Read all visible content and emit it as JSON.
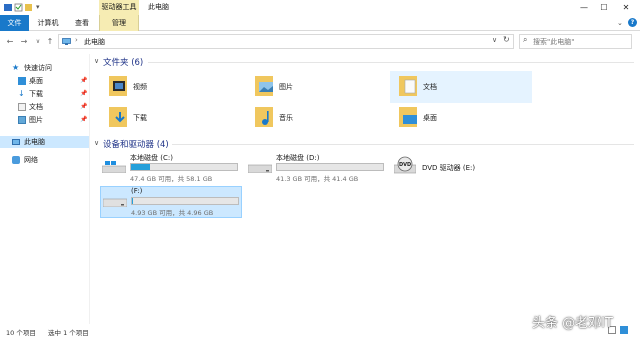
{
  "window": {
    "title": "此电脑",
    "contextual_group": "驱动器工具"
  },
  "ribbon": {
    "tabs": [
      "文件",
      "计算机",
      "查看",
      "管理"
    ]
  },
  "address": {
    "crumb": "此电脑",
    "search_placeholder": "搜索\"此电脑\""
  },
  "sidebar": {
    "quick_access": "快速访问",
    "items": [
      "桌面",
      "下载",
      "文档",
      "图片"
    ],
    "this_pc": "此电脑",
    "network": "网络"
  },
  "folders": {
    "header": "文件夹 (6)",
    "items": [
      "视频",
      "图片",
      "文档",
      "下载",
      "音乐",
      "桌面"
    ]
  },
  "drives": {
    "header": "设备和驱动器 (4)",
    "items": [
      {
        "name": "本地磁盘 (C:)",
        "size": "47.4 GB 可用，共 58.1 GB",
        "used": 0.18
      },
      {
        "name": "本地磁盘 (D:)",
        "size": "41.3 GB 可用，共 41.4 GB",
        "used": 0.0
      },
      {
        "name": "DVD 驱动器 (E:)"
      },
      {
        "name": "(F:)",
        "size": "4.93 GB 可用，共 4.96 GB",
        "used": 0.006
      }
    ]
  },
  "statusbar": {
    "count": "10 个项目",
    "selected": "选中 1 个项目"
  },
  "watermark": "头条 @老邓IT",
  "colors": {
    "accent": "#1979ca",
    "drive_fill": "#26a0da",
    "selected_bg": "#cce8ff",
    "hover_bg": "#e5f3ff",
    "tools_tab": "#f6ecb3"
  }
}
